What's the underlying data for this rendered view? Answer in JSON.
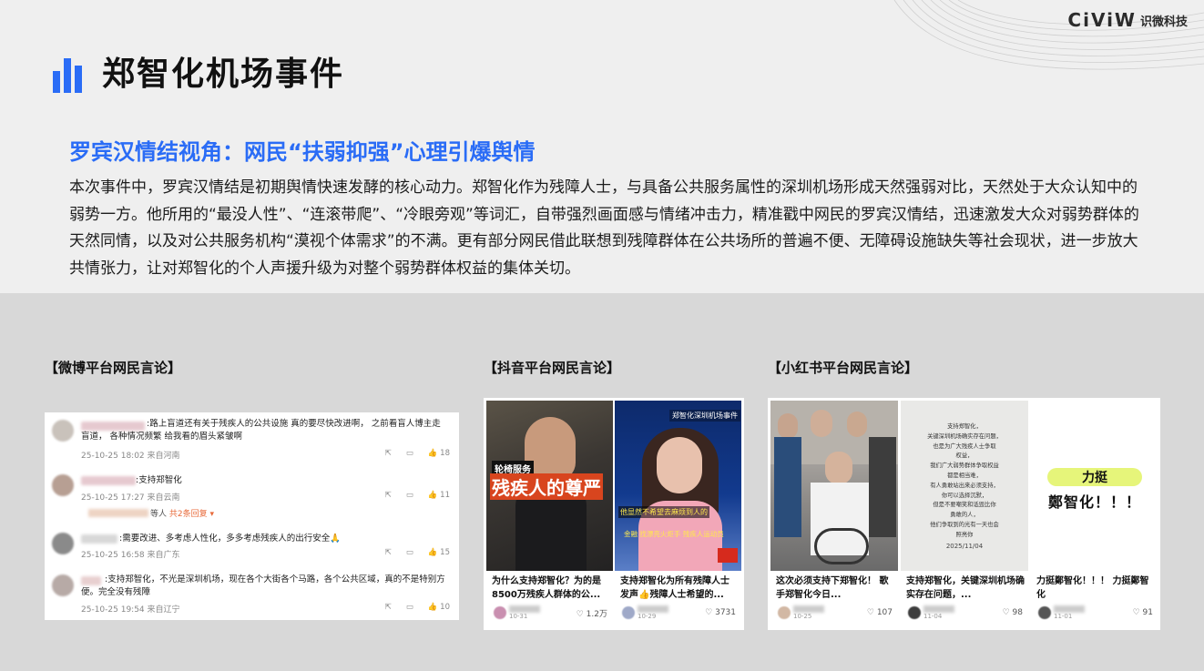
{
  "brand": {
    "mark": "CiViW",
    "name": "识微科技"
  },
  "page_title": "郑智化机场事件",
  "subtitle": "罗宾汉情结视角：网民“扶弱抑强”心理引爆舆情",
  "body_text": "本次事件中，罗宾汉情结是初期舆情快速发酵的核心动力。郑智化作为残障人士，与具备公共服务属性的深圳机场形成天然强弱对比，天然处于大众认知中的弱势一方。他所用的“最没人性”、“连滚带爬”、“冷眼旁观”等词汇，自带强烈画面感与情绪冲击力，精准戳中网民的罗宾汉情结，迅速激发大众对弱势群体的天然同情，以及对公共服务机构“漠视个体需求”的不满。更有部分网民借此联想到残障群体在公共场所的普遍不便、无障碍设施缺失等社会现状，进一步放大共情张力，让对郑智化的个人声援升级为对整个弱势群体权益的集体关切。",
  "sections": {
    "weibo": "【微博平台网民言论】",
    "douyin": "【抖音平台网民言论】",
    "xhs": "【小红书平台网民言论】"
  },
  "weibo_comments": [
    {
      "text": ":路上盲道还有关于残疾人的公共设施 真的要尽快改进啊， 之前看盲人博主走盲道， 各种情况频繁 给我看的眉头紧皱啊",
      "meta": "25-10-25 18:02 来自河南",
      "likes": "18"
    },
    {
      "text": ":支持郑智化",
      "meta": "25-10-25 17:27 来自云南",
      "likes": "11",
      "reply_prefix": "等人",
      "reply_link": "共2条回复 ▾"
    },
    {
      "text": ":需要改进、多考虑人性化，多多考虑残疾人的出行安全🙏",
      "meta": "25-10-25 16:58 来自广东",
      "likes": "15"
    },
    {
      "text": ":支持郑智化，不光是深圳机场，现在各个大街各个马路，各个公共区域，真的不是特别方便。完全没有残障",
      "meta": "25-10-25 19:54 来自辽宁",
      "likes": "10"
    }
  ],
  "douyin_cards": [
    {
      "overlay_top": "轮椅服务",
      "overlay_main": "残疾人的尊严",
      "caption": "为什么支持郑智化？为的是8500万残疾人群体的公...",
      "date": "10-31",
      "likes": "1.2万"
    },
    {
      "overlay_top": "郑智化深圳机场事件",
      "overlay_main": "他显然不希望去麻烦到人的",
      "overlay_sub": "金融 找漂亮火炬手 残疾人运动员",
      "caption": "支持郑智化为所有残障人士发声👍残障人士希望的...",
      "date": "10-29",
      "likes": "3731"
    }
  ],
  "xhs_cards": [
    {
      "caption": "这次必须支持下郑智化！ 歌手郑智化今日...",
      "date": "10-25",
      "likes": "107"
    },
    {
      "note_lines": [
        "支持郑智化，",
        "关键深圳机场确实存在问题，",
        "也是为广大残疾人士争取",
        "权益，",
        "我们广大弱势群体争取权益",
        "都是相当难，",
        "有人勇敢站出来必须支持，",
        "你可以选择沉默，",
        "但是不要嘲笑和诋毁比你",
        "勇敢的人，",
        "他们争取到的光有一天也会",
        "照亮你"
      ],
      "note_date": "2025/11/04",
      "caption": "支持郑智化，关键深圳机场确实存在问题，...",
      "date": "11-04",
      "likes": "98"
    },
    {
      "banner_top": "力挺",
      "banner_main": "鄭智化！！！",
      "caption": "力挺鄭智化！！！ 力挺鄭智化",
      "date": "11-01",
      "likes": "91"
    }
  ]
}
